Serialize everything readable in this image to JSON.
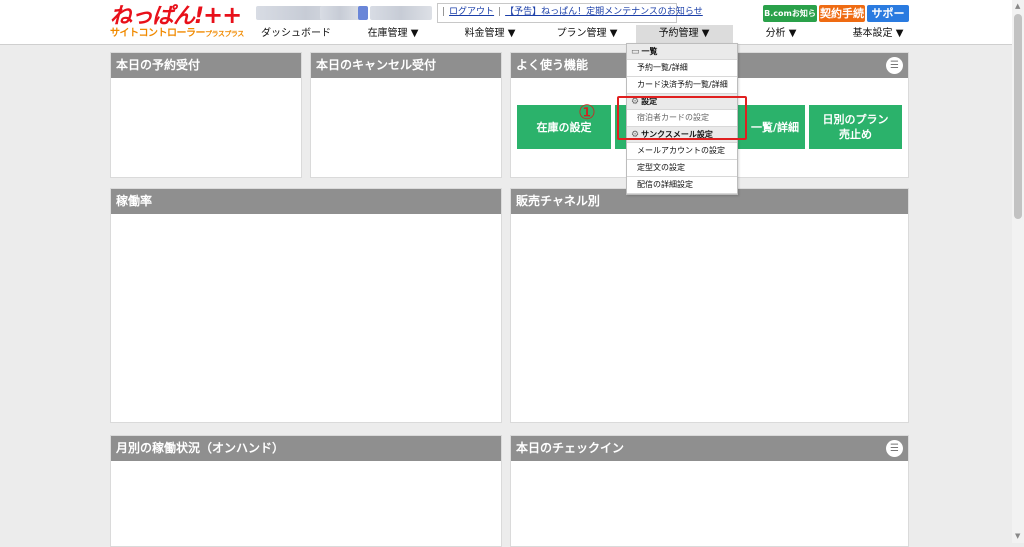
{
  "header": {
    "logo_main": "ねっぱん!",
    "logo_plus": "++",
    "logo_sub": "サイトコントローラー",
    "logo_sub_small": "プラスプラス",
    "logout_link": "ログアウト",
    "maintenance_link": "【予告】ねっぱん！定期メンテナンスのお知らせ",
    "btn_bcom": "B.comお知らせ",
    "btn_contract": "契約手続",
    "btn_support": "サポート"
  },
  "nav": [
    {
      "label": "ダッシュボード"
    },
    {
      "label": "在庫管理 ▼"
    },
    {
      "label": "料金管理 ▼"
    },
    {
      "label": "プラン管理 ▼"
    },
    {
      "label": "予約管理 ▼"
    },
    {
      "label": "分析 ▼"
    },
    {
      "label": "基本設定 ▼"
    }
  ],
  "panels": {
    "today_reservations": "本日の予約受付",
    "today_cancellations": "本日のキャンセル受付",
    "favorites": "よく使う機能",
    "occupancy": "稼働率",
    "sales_channel": "販売チャネル別",
    "monthly_occupancy": "月別の稼働状況（オンハンド）",
    "today_checkin": "本日のチェックイン"
  },
  "favorites": {
    "btn1": "在庫の設定",
    "btn3": "一覧/詳細",
    "btn4_line1": "日別のプラン",
    "btn4_line2": "売止め"
  },
  "dropdown": {
    "section_list": "一覧",
    "reservation_list": "予約一覧/詳細",
    "card_reservation_list": "カード決済予約一覧/詳細",
    "section_settings": "設定",
    "guest_card_settings": "宿泊者カードの設定",
    "thanks_mail_settings": "サンクスメール設定",
    "mail_account_settings": "メールアカウントの設定",
    "template_settings": "定型文の設定",
    "delivery_detail_settings": "配信の詳細設定"
  },
  "annotation": "①",
  "colors": {
    "brand_red": "#e8101a",
    "accent_green": "#2bb26b",
    "panel_head": "#8f8f8f",
    "highlight": "#e02020"
  }
}
